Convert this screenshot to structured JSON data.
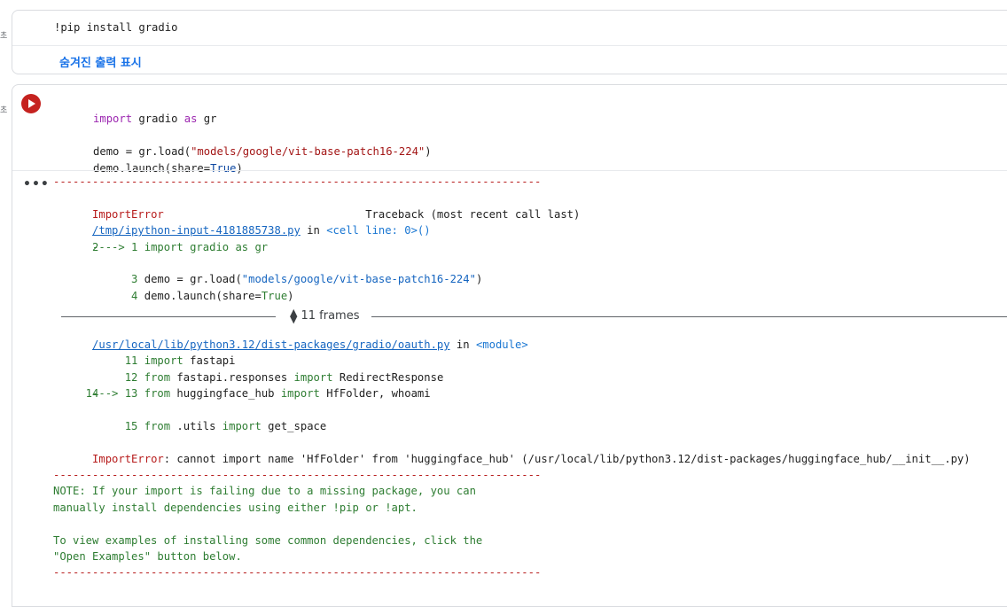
{
  "gutter": {
    "mark1": "초",
    "mark2": "초"
  },
  "cell1": {
    "code": "!pip install gradio",
    "show_hidden_label": "숨겨진 출력 표시"
  },
  "cell2": {
    "code": {
      "l1_kw1": "import",
      "l1_mid": " gradio ",
      "l1_kw2": "as",
      "l1_end": " gr",
      "l3_a": "demo = gr.load(",
      "l3_str": "\"models/google/vit-base-patch16-224\"",
      "l3_b": ")",
      "l4_a": "demo.launch(share=",
      "l4_kw": "True",
      "l4_b": ")"
    },
    "output_menu_icon": "more-horiz-icon",
    "output": {
      "dash": "---------------------------------------------------------------------------",
      "err_name": "ImportError",
      "traceback_head": "                               Traceback (most recent call last)",
      "file1": "/tmp/ipython-input-4181885738.py",
      "file1_in": " in ",
      "file1_loc": "<cell line: 0>()",
      "t1_arrow": "----> 1 ",
      "t1_code": "import gradio as gr",
      "t2": "      2",
      "t3_num": "      3 ",
      "t3_a": "demo = gr.load(",
      "t3_str": "\"models/google/vit-base-patch16-224\"",
      "t3_b": ")",
      "t4_num": "      4 ",
      "t4_a": "demo.launch(share=",
      "t4_kw": "True",
      "t4_b": ")",
      "frames_label": "11 frames",
      "file2": "/usr/local/lib/python3.12/dist-packages/gradio/oauth.py",
      "file2_in": " in ",
      "file2_loc": "<module>",
      "f11_num": "     11 ",
      "f11_kw": "import",
      "f11_rest": " fastapi",
      "f12_num": "     12 ",
      "f12_kw1": "from",
      "f12_mid": " fastapi.responses ",
      "f12_kw2": "import",
      "f12_rest": " RedirectResponse",
      "f13_num": "---> 13 ",
      "f13_kw1": "from",
      "f13_mid": " huggingface_hub ",
      "f13_kw2": "import",
      "f13_rest": " HfFolder, whoami",
      "f14": "     14",
      "f15_num": "     15 ",
      "f15_kw1": "from",
      "f15_mid": " .utils ",
      "f15_kw2": "import",
      "f15_rest": " get_space",
      "final_err": "ImportError",
      "final_msg": ": cannot import name 'HfFolder' from 'huggingface_hub' (/usr/local/lib/python3.12/dist-packages/huggingface_hub/__init__.py)",
      "note1": "NOTE: If your import is failing due to a missing package, you can",
      "note2": "manually install dependencies using either !pip or !apt.",
      "note3": "To view examples of installing some common dependencies, click the",
      "note4": "\"Open Examples\" button below."
    }
  },
  "colors": {
    "run_button": "#c5221f",
    "link": "#1a73e8",
    "error_red": "#b71c1c",
    "code_green": "#2e7d32",
    "keyword_purple": "#9c27b0"
  }
}
